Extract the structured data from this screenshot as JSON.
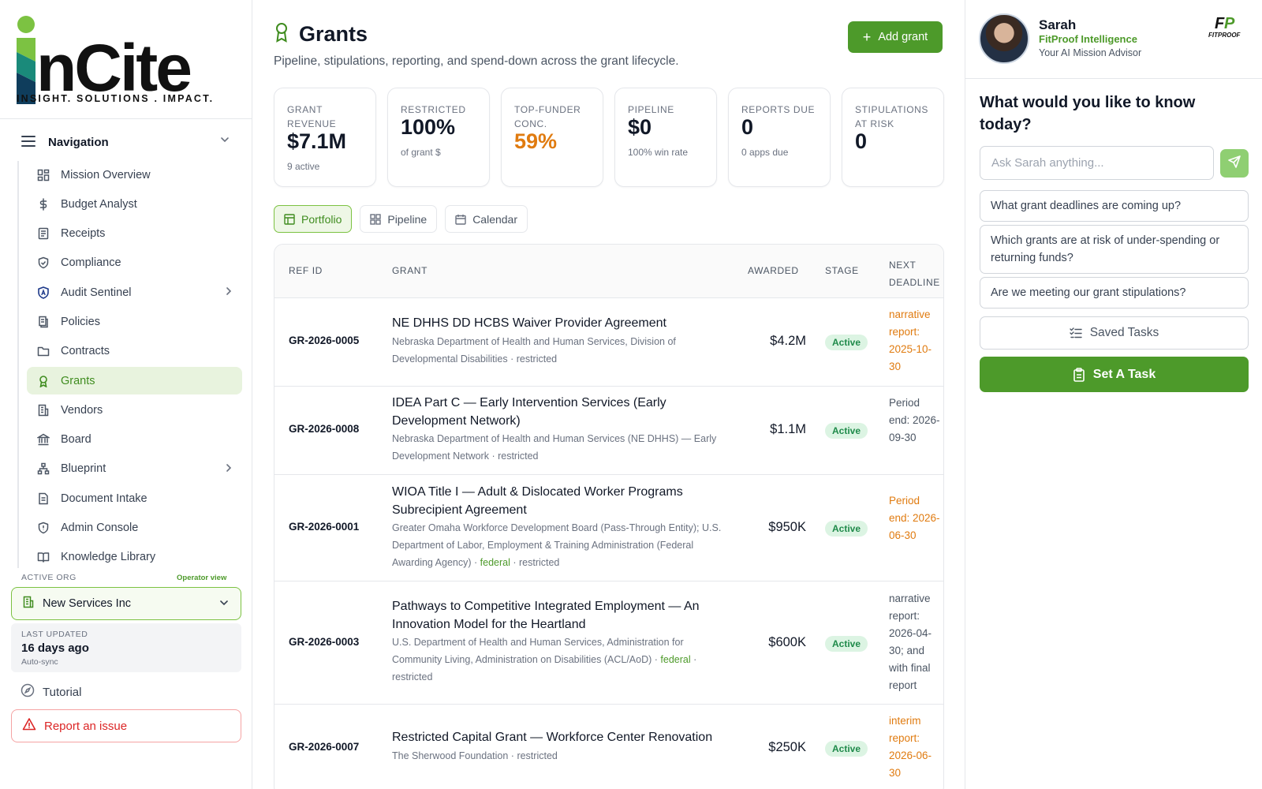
{
  "brand": {
    "logo_text": "nCite",
    "tagline": "INSIGHT. SOLUTIONS . IMPACT.",
    "accent": "#4d9a2a",
    "accent_light": "#7cc242"
  },
  "sidebar": {
    "nav_label": "Navigation",
    "items": [
      {
        "label": "Mission Overview",
        "icon": "dashboard-icon"
      },
      {
        "label": "Budget Analyst",
        "icon": "dollar-icon"
      },
      {
        "label": "Receipts",
        "icon": "receipt-icon"
      },
      {
        "label": "Compliance",
        "icon": "shield-check-icon"
      },
      {
        "label": "Audit Sentinel",
        "icon": "shield-a-icon"
      },
      {
        "label": "Policies",
        "icon": "policy-doc-icon"
      },
      {
        "label": "Contracts",
        "icon": "folder-icon"
      },
      {
        "label": "Grants",
        "icon": "award-icon"
      },
      {
        "label": "Vendors",
        "icon": "building-icon"
      },
      {
        "label": "Board",
        "icon": "bank-icon"
      },
      {
        "label": "Blueprint",
        "icon": "org-chart-icon"
      },
      {
        "label": "Document Intake",
        "icon": "file-icon"
      },
      {
        "label": "Admin Console",
        "icon": "shield-alert-icon"
      },
      {
        "label": "Knowledge Library",
        "icon": "book-icon"
      }
    ],
    "active_org_label": "ACTIVE ORG",
    "operator_view": "Operator view",
    "org_name": "New Services Inc",
    "last_updated_label": "LAST UPDATED",
    "last_updated_value": "16 days ago",
    "auto_sync": "Auto-sync",
    "tutorial": "Tutorial",
    "report_issue": "Report an issue"
  },
  "main": {
    "title": "Grants",
    "subtitle": "Pipeline, stipulations, reporting, and spend-down across the grant lifecycle.",
    "add_button": "Add grant",
    "kpis": [
      {
        "label": "GRANT REVENUE",
        "value": "$7.1M",
        "sub": "9 active"
      },
      {
        "label": "RESTRICTED",
        "value": "100%",
        "sub": "of grant $"
      },
      {
        "label": "TOP-FUNDER CONC.",
        "value": "59%",
        "sub": ""
      },
      {
        "label": "PIPELINE",
        "value": "$0",
        "sub": "100% win rate"
      },
      {
        "label": "REPORTS DUE",
        "value": "0",
        "sub": "0 apps due"
      },
      {
        "label": "STIPULATIONS AT RISK",
        "value": "0",
        "sub": ""
      }
    ],
    "tabs": [
      "Portfolio",
      "Pipeline",
      "Calendar"
    ],
    "table": {
      "headers": {
        "ref": "REF ID",
        "grant": "GRANT",
        "awarded": "AWARDED",
        "stage": "STAGE",
        "next": "NEXT DEADLINE"
      },
      "rows": [
        {
          "ref": "GR-2026-0005",
          "title": "NE DHHS DD HCBS Waiver Provider Agreement",
          "funder": "Nebraska Department of Health and Human Services, Division of Developmental Disabilities",
          "federal": "",
          "tag": "restricted",
          "awarded": "$4.2M",
          "stage": "Active",
          "next": "narrative report: 2025-10-30"
        },
        {
          "ref": "GR-2026-0008",
          "title": "IDEA Part C — Early Intervention Services (Early Development Network)",
          "funder": "Nebraska Department of Health and Human Services (NE DHHS) — Early Development Network",
          "federal": "",
          "tag": "restricted",
          "awarded": "$1.1M",
          "stage": "Active",
          "next": "Period end: 2026-09-30"
        },
        {
          "ref": "GR-2026-0001",
          "title": "WIOA Title I — Adult & Dislocated Worker Programs Subrecipient Agreement",
          "funder": "Greater Omaha Workforce Development Board (Pass-Through Entity); U.S. Department of Labor, Employment & Training Administration (Federal Awarding Agency)",
          "federal": "federal",
          "tag": "restricted",
          "awarded": "$950K",
          "stage": "Active",
          "next": "Period end: 2026-06-30"
        },
        {
          "ref": "GR-2026-0003",
          "title": "Pathways to Competitive Integrated Employment — An Innovation Model for the Heartland",
          "funder": "U.S. Department of Health and Human Services, Administration for Community Living, Administration on Disabilities (ACL/AoD)",
          "federal": "federal",
          "tag": "restricted",
          "awarded": "$600K",
          "stage": "Active",
          "next": "narrative report: 2026-04-30; and with final report"
        },
        {
          "ref": "GR-2026-0007",
          "title": "Restricted Capital Grant — Workforce Center Renovation",
          "funder": "The Sherwood Foundation",
          "federal": "",
          "tag": "restricted",
          "awarded": "$250K",
          "stage": "Active",
          "next": "interim report: 2026-06-30"
        }
      ]
    }
  },
  "advisor": {
    "name": "Sarah",
    "org": "FitProof Intelligence",
    "role": "Your AI Mission Advisor",
    "logo_text": "FITPROOF",
    "question": "What would you like to know today?",
    "ask_placeholder": "Ask Sarah anything...",
    "suggestions": [
      "What grant deadlines are coming up?",
      "Which grants are at risk of under-spending or returning funds?",
      "Are we meeting our grant stipulations?"
    ],
    "saved_tasks": "Saved Tasks",
    "set_task": "Set A Task"
  }
}
